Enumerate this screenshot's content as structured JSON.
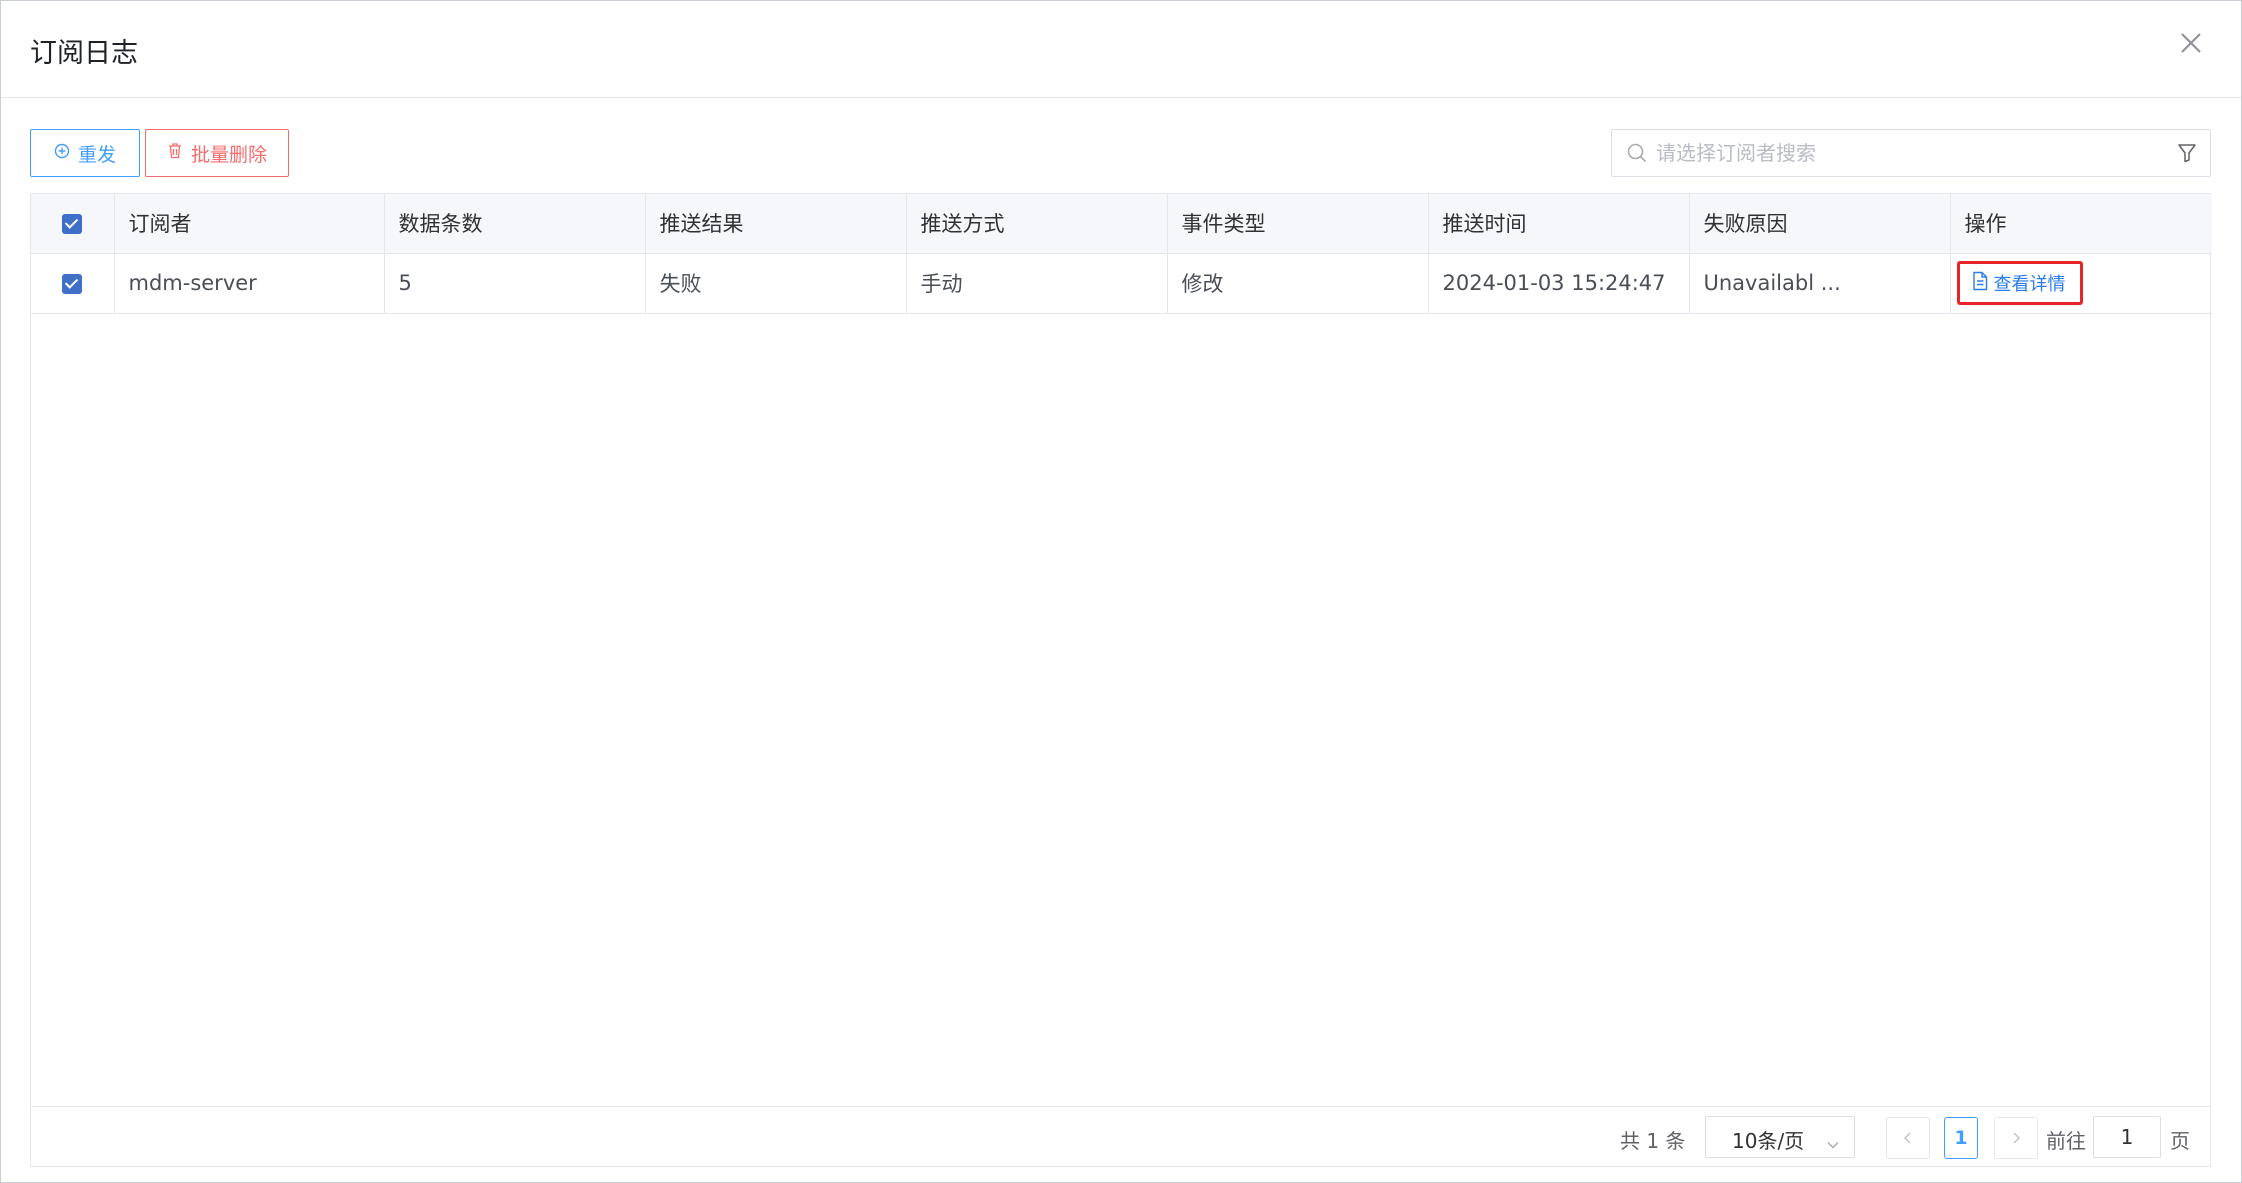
{
  "dialog": {
    "title": "订阅日志"
  },
  "toolbar": {
    "resend_label": "重发",
    "batch_delete_label": "批量删除",
    "search_placeholder": "请选择订阅者搜索",
    "search_value": ""
  },
  "table": {
    "headers": [
      "订阅者",
      "数据条数",
      "推送结果",
      "推送方式",
      "事件类型",
      "推送时间",
      "失败原因",
      "操作"
    ],
    "rows": [
      {
        "checked": true,
        "subscriber": "mdm-server",
        "count": "5",
        "result": "失败",
        "method": "手动",
        "event_type": "修改",
        "push_time": "2024-01-03 15:24:47",
        "fail_reason": "Unavailabl ...",
        "action_label": "查看详情"
      }
    ]
  },
  "pagination": {
    "total_text": "共 1 条",
    "page_size": "10条/页",
    "current_page": "1",
    "goto_label": "前往",
    "goto_value": "1",
    "page_suffix": "页"
  },
  "colors": {
    "primary": "#409eff",
    "danger": "#f56c6c",
    "checkbox": "#3f70c7",
    "highlight": "#e8262a"
  }
}
